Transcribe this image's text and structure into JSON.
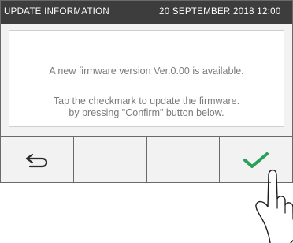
{
  "header": {
    "title": "UPDATE INFORMATION",
    "datetime": "20 SEPTEMBER 2018 12:00"
  },
  "message": {
    "line1": "A new firmware version Ver.0.00 is available.",
    "line2": "Tap the checkmark to update the firmware.",
    "line3": "by pressing \"Confirm\" button below."
  },
  "buttons": {
    "back_icon": "back-arrow-icon",
    "confirm_icon": "checkmark-icon",
    "confirm_color": "#2aa05a"
  }
}
